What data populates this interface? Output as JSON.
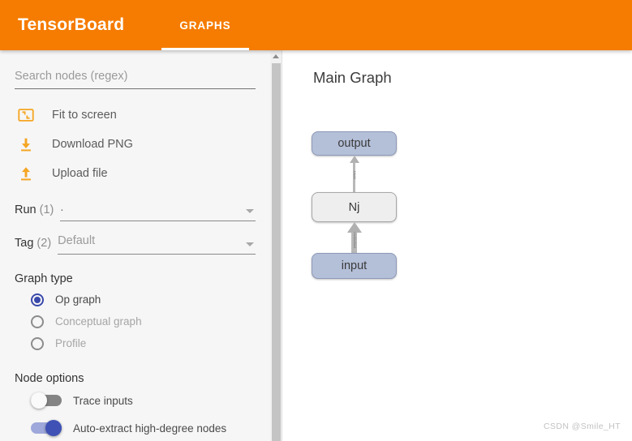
{
  "header": {
    "brand": "TensorBoard",
    "accent_color": "#f57c00",
    "tabs": [
      {
        "label": "GRAPHS",
        "active": true
      }
    ]
  },
  "sidebar": {
    "search": {
      "name": "search-nodes",
      "value": "",
      "placeholder": "Search nodes (regex)"
    },
    "actions": [
      {
        "label": "Fit to screen",
        "icon": "fit-to-screen-icon"
      },
      {
        "label": "Download PNG",
        "icon": "download-icon"
      },
      {
        "label": "Upload file",
        "icon": "upload-icon"
      }
    ],
    "selectors": [
      {
        "label": "Run",
        "count": "(1)",
        "value": ".",
        "placeholder": ".",
        "filled": true,
        "options": [
          "."
        ]
      },
      {
        "label": "Tag",
        "count": "(2)",
        "value": "Default",
        "placeholder": "Default",
        "filled": false,
        "options": [
          "Default"
        ]
      }
    ],
    "graph_type": {
      "title": "Graph type",
      "selected": "Op graph",
      "options": [
        {
          "label": "Op graph",
          "checked": true,
          "disabled": false
        },
        {
          "label": "Conceptual graph",
          "checked": false,
          "disabled": true
        },
        {
          "label": "Profile",
          "checked": false,
          "disabled": true
        }
      ]
    },
    "node_options": {
      "title": "Node options",
      "toggles": [
        {
          "label": "Trace inputs",
          "on": false
        },
        {
          "label": "Auto-extract high-degree nodes",
          "on": true
        }
      ]
    }
  },
  "scrollbar": {
    "up_arrow": "scroll-up-arrow-icon"
  },
  "canvas": {
    "title": "Main Graph",
    "nodes": [
      {
        "id": "output",
        "label": "output",
        "kind": "io",
        "fill": "#b4bfd8"
      },
      {
        "id": "nj",
        "label": "Nj",
        "kind": "op",
        "fill": "#eeeeee"
      },
      {
        "id": "input",
        "label": "input",
        "kind": "io",
        "fill": "#b4bfd8"
      }
    ],
    "edges": [
      {
        "id": "nj-to-output",
        "from": "Nj",
        "to": "output",
        "label": "10x10"
      },
      {
        "id": "input-to-nj",
        "from": "input",
        "to": "Nj",
        "label": "10x32x32x3"
      }
    ]
  },
  "watermark": {
    "text": "CSDN @Smile_HT"
  }
}
